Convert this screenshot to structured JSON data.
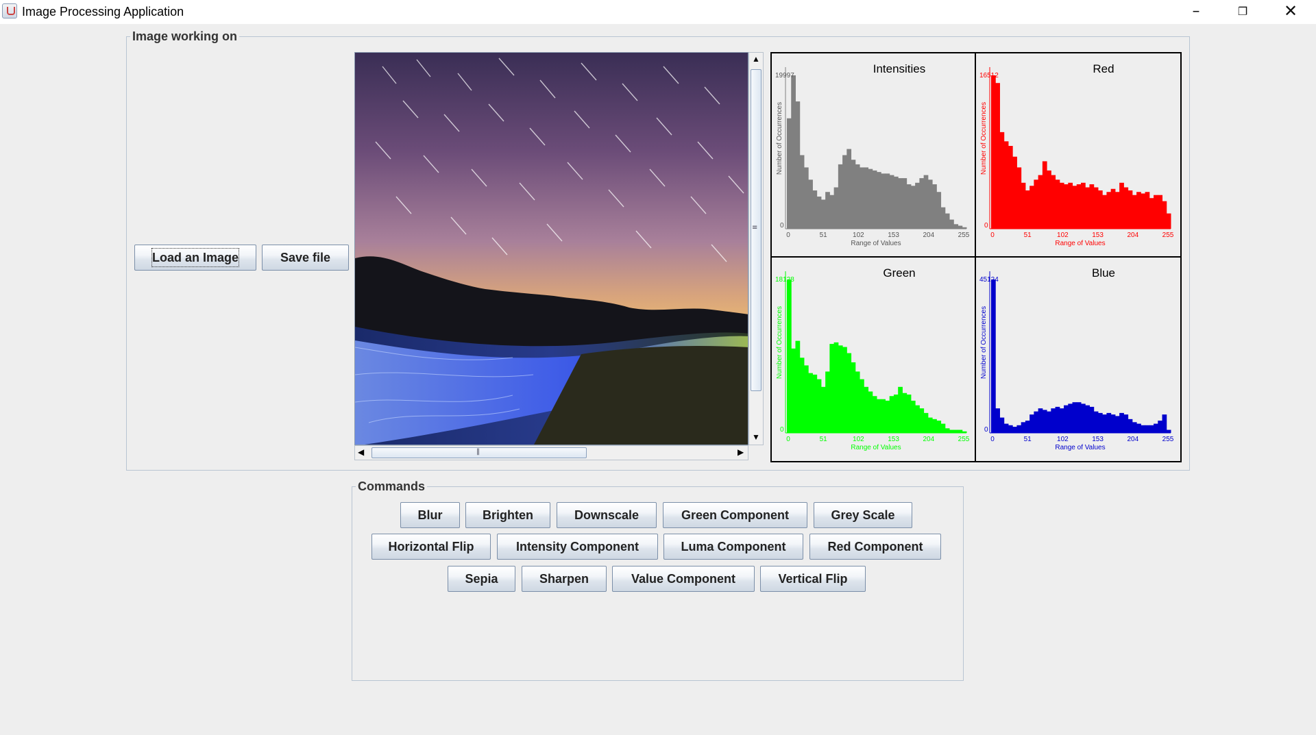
{
  "window": {
    "title": "Image Processing Application",
    "controls": [
      "minimize",
      "restore",
      "close"
    ]
  },
  "image_panel": {
    "legend": "Image working on",
    "load_button": "Load an Image",
    "save_button": "Save file",
    "image_description": "night sky with star trails over a field with glowing blue lights"
  },
  "histograms": [
    {
      "title": "Intensities",
      "color": "#808080",
      "max_label": "19997",
      "zero_label": "0",
      "ylabel": "Number of Occurrences",
      "xlabel": "Range of Values",
      "ticks": [
        "0",
        "51",
        "102",
        "153",
        "204",
        "255"
      ],
      "values": [
        0.72,
        1.0,
        0.83,
        0.48,
        0.4,
        0.32,
        0.25,
        0.21,
        0.19,
        0.24,
        0.22,
        0.27,
        0.42,
        0.48,
        0.52,
        0.45,
        0.42,
        0.4,
        0.4,
        0.39,
        0.38,
        0.37,
        0.36,
        0.36,
        0.35,
        0.34,
        0.33,
        0.33,
        0.29,
        0.28,
        0.3,
        0.33,
        0.35,
        0.32,
        0.29,
        0.24,
        0.14,
        0.1,
        0.06,
        0.03,
        0.02,
        0.01
      ]
    },
    {
      "title": "Red",
      "color": "#ff0000",
      "max_label": "16512",
      "zero_label": "0",
      "ylabel": "Number of Occurrences",
      "xlabel": "Range of Values",
      "ticks": [
        "0",
        "51",
        "102",
        "153",
        "204",
        "255"
      ],
      "values": [
        1.0,
        0.95,
        0.63,
        0.57,
        0.54,
        0.47,
        0.4,
        0.3,
        0.25,
        0.28,
        0.32,
        0.35,
        0.44,
        0.38,
        0.35,
        0.32,
        0.3,
        0.29,
        0.3,
        0.28,
        0.29,
        0.3,
        0.27,
        0.29,
        0.27,
        0.25,
        0.22,
        0.24,
        0.26,
        0.24,
        0.3,
        0.27,
        0.25,
        0.22,
        0.24,
        0.23,
        0.24,
        0.2,
        0.22,
        0.22,
        0.18,
        0.1
      ]
    },
    {
      "title": "Green",
      "color": "#00ff00",
      "max_label": "18128",
      "zero_label": "0",
      "ylabel": "Number of Occurrences",
      "xlabel": "Range of Values",
      "ticks": [
        "0",
        "51",
        "102",
        "153",
        "204",
        "255"
      ],
      "values": [
        1.0,
        0.55,
        0.6,
        0.49,
        0.44,
        0.39,
        0.38,
        0.35,
        0.3,
        0.4,
        0.58,
        0.59,
        0.57,
        0.56,
        0.52,
        0.46,
        0.4,
        0.35,
        0.3,
        0.27,
        0.24,
        0.22,
        0.22,
        0.21,
        0.24,
        0.25,
        0.3,
        0.26,
        0.25,
        0.21,
        0.18,
        0.16,
        0.13,
        0.1,
        0.09,
        0.08,
        0.06,
        0.03,
        0.02,
        0.02,
        0.02,
        0.01
      ]
    },
    {
      "title": "Blue",
      "color": "#0000cc",
      "max_label": "45124",
      "zero_label": "0",
      "ylabel": "Number of Occurrences",
      "xlabel": "Range of Values",
      "ticks": [
        "0",
        "51",
        "102",
        "153",
        "204",
        "255"
      ],
      "values": [
        1.0,
        0.16,
        0.1,
        0.06,
        0.05,
        0.04,
        0.05,
        0.07,
        0.08,
        0.12,
        0.14,
        0.16,
        0.15,
        0.14,
        0.16,
        0.17,
        0.16,
        0.18,
        0.19,
        0.2,
        0.2,
        0.19,
        0.18,
        0.17,
        0.14,
        0.13,
        0.12,
        0.13,
        0.12,
        0.11,
        0.13,
        0.12,
        0.09,
        0.07,
        0.06,
        0.05,
        0.05,
        0.05,
        0.06,
        0.08,
        0.12,
        0.02
      ]
    }
  ],
  "commands": {
    "legend": "Commands",
    "rows": [
      [
        "Blur",
        "Brighten",
        "Downscale",
        "Green Component",
        "Grey Scale"
      ],
      [
        "Horizontal Flip",
        "Intensity Component",
        "Luma Component",
        "Red Component"
      ],
      [
        "Sepia",
        "Sharpen",
        "Value Component",
        "Vertical Flip"
      ]
    ]
  }
}
